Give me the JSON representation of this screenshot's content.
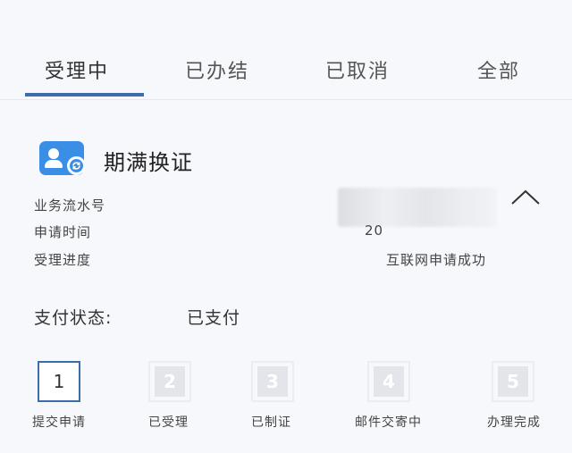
{
  "tabs": [
    {
      "label": "受理中",
      "active": true
    },
    {
      "label": "已办结",
      "active": false
    },
    {
      "label": "已取消",
      "active": false
    },
    {
      "label": "全部",
      "active": false
    }
  ],
  "service": {
    "icon": "user-renew-icon",
    "title": "期满换证"
  },
  "fields": {
    "serial_label": "业务流水号",
    "time_label": "申请时间",
    "time_value_visible": "20",
    "progress_label": "受理进度",
    "progress_value": "互联网申请成功"
  },
  "payment": {
    "label": "支付状态:",
    "value": "已支付"
  },
  "steps": [
    {
      "number": "1",
      "label": "提交申请",
      "active": true
    },
    {
      "number": "2",
      "label": "已受理",
      "active": false
    },
    {
      "number": "3",
      "label": "已制证",
      "active": false
    },
    {
      "number": "4",
      "label": "邮件交寄中",
      "active": false
    },
    {
      "number": "5",
      "label": "办理完成",
      "active": false
    }
  ],
  "colors": {
    "accent": "#3b6ea8",
    "icon_blue": "#3a8ee6",
    "inactive_step": "#e3e5ea"
  }
}
